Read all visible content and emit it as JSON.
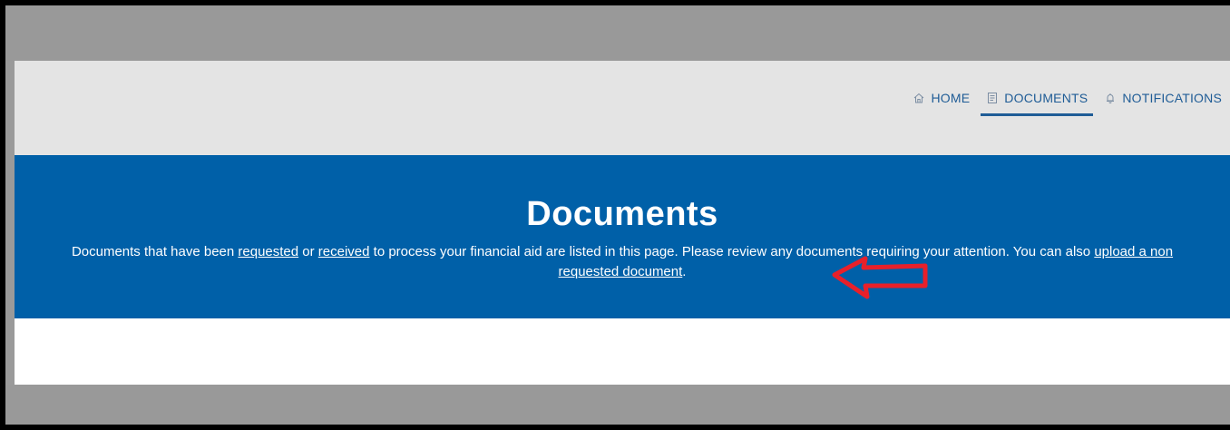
{
  "nav": {
    "items": [
      {
        "label": "HOME",
        "icon": "home-icon"
      },
      {
        "label": "DOCUMENTS",
        "icon": "document-icon",
        "active": true
      },
      {
        "label": "NOTIFICATIONS",
        "icon": "bell-icon"
      }
    ]
  },
  "banner": {
    "title": "Documents",
    "text_1": "Documents that have been ",
    "link_requested": "requested",
    "text_2": " or ",
    "link_received": "received",
    "text_3": " to process your financial aid are listed in this page. Please review any documents requiring your attention. You can also ",
    "link_upload": "upload a non requested document",
    "text_4": "."
  },
  "annotation": {
    "arrow_color": "#e8202a"
  },
  "colors": {
    "banner_bg": "#0060a8",
    "nav_text": "#1f5c96",
    "nav_bg": "#e4e4e4"
  }
}
